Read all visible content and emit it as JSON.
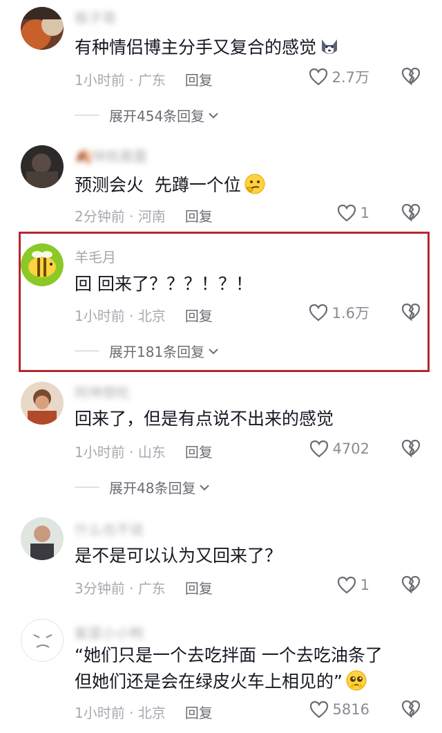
{
  "comments": [
    {
      "username": "板子哥",
      "text": "有种情侣博主分手又复合的感觉",
      "time": "1小时前",
      "location": "广东",
      "reply": "回复",
      "likes": "2.7万",
      "expand": "展开454条回复",
      "emoji": "husky-dog-emoji"
    },
    {
      "username": "🍂林枝晨露",
      "text": "预测会火  先蹲一个位",
      "time": "2分钟前",
      "location": "河南",
      "reply": "回复",
      "likes": "1",
      "emoji": "thinking-face-emoji"
    },
    {
      "username": "羊毛月",
      "text": "回 回来了？？？！？！",
      "time": "1小时前",
      "location": "北京",
      "reply": "回复",
      "likes": "1.6万",
      "expand": "展开181条回复"
    },
    {
      "username": "阿坤想吃",
      "text": "回来了，但是有点说不出来的感觉",
      "time": "1小时前",
      "location": "山东",
      "reply": "回复",
      "likes": "4702",
      "expand": "展开48条回复"
    },
    {
      "username": "什么也不说",
      "text": "是不是可以认为又回来了？",
      "time": "3分钟前",
      "location": "广东",
      "reply": "回复",
      "likes": "1"
    },
    {
      "username": "紫菜小小鸭",
      "text_line1": "“她们只是一个去吃拌面 一个去吃油条了",
      "text_line2": "但她们还是会在绿皮火车上相见的”",
      "time": "1小时前",
      "location": "北京",
      "reply": "回复",
      "likes": "5816",
      "emoji": "pleading-face-emoji"
    }
  ],
  "colors": {
    "highlight": "#b5272d",
    "text": "#161823",
    "meta": "#a8a8b0"
  }
}
